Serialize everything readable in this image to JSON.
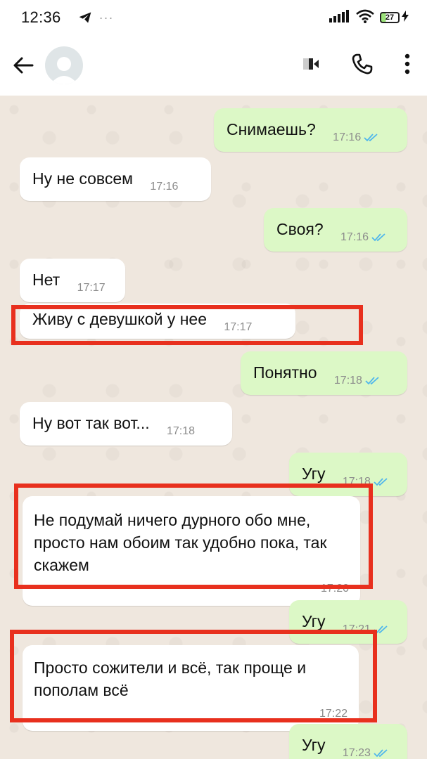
{
  "status_bar": {
    "time": "12:36",
    "dots": "···",
    "battery": "27",
    "icons": [
      "telegram-icon",
      "signal-icon",
      "wifi-icon",
      "battery-icon",
      "charging-icon"
    ]
  },
  "header": {
    "icons": [
      "back-arrow-icon",
      "avatar-icon",
      "video-call-icon",
      "phone-icon",
      "more-vert-icon"
    ]
  },
  "messages": [
    {
      "dir": "out",
      "text": "Снимаешь?",
      "time": "17:16",
      "read": true
    },
    {
      "dir": "in",
      "text": "Ну не совсем",
      "time": "17:16"
    },
    {
      "dir": "out",
      "text": "Своя?",
      "time": "17:16",
      "read": true
    },
    {
      "dir": "in",
      "text": "Нет",
      "time": "17:17"
    },
    {
      "dir": "in",
      "text": "Живу с девушкой у нее",
      "time": "17:17",
      "highlighted": true
    },
    {
      "dir": "out",
      "text": "Понятно",
      "time": "17:18",
      "read": true
    },
    {
      "dir": "in",
      "text": "Ну вот так вот...",
      "time": "17:18"
    },
    {
      "dir": "out",
      "text": "Угу",
      "time": "17:18",
      "read": true
    },
    {
      "dir": "in",
      "text": "Не подумай ничего дурного обо мне, просто нам обоим так удобно пока, так скажем",
      "time": "17:20",
      "highlighted": true
    },
    {
      "dir": "out",
      "text": "Угу",
      "time": "17:21",
      "read": true
    },
    {
      "dir": "in",
      "text": "Просто сожители и всё, так проще и пополам всё",
      "time": "17:22",
      "highlighted": true
    },
    {
      "dir": "out",
      "text": "Угу",
      "time": "17:23",
      "read": true
    }
  ],
  "colors": {
    "incoming": "#ffffff",
    "outgoing": "#dcf8c6",
    "highlight": "#e8301e",
    "read_ticks": "#4fb6ec"
  }
}
